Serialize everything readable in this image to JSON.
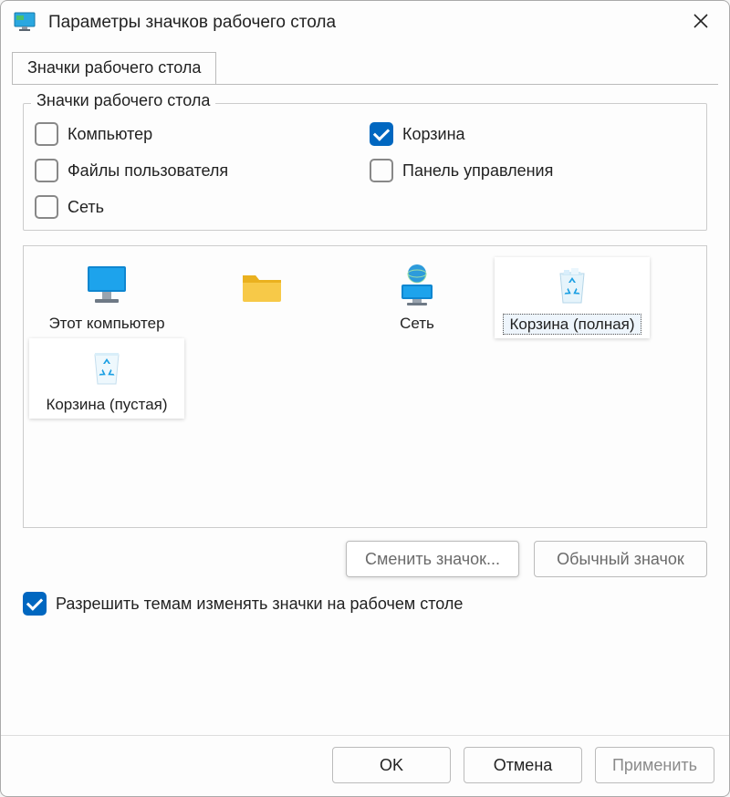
{
  "title": "Параметры значков рабочего стола",
  "tab": {
    "label": "Значки рабочего стола"
  },
  "group": {
    "label": "Значки рабочего стола",
    "checkboxes": [
      {
        "label": "Компьютер",
        "checked": false
      },
      {
        "label": "Корзина",
        "checked": true
      },
      {
        "label": "Файлы пользователя",
        "checked": false
      },
      {
        "label": "Панель управления",
        "checked": false
      },
      {
        "label": "Сеть",
        "checked": false
      }
    ]
  },
  "icons": [
    {
      "label": "Этот компьютер",
      "type": "monitor",
      "selected": false,
      "highlight": false
    },
    {
      "label": "",
      "type": "folder",
      "selected": false,
      "highlight": false
    },
    {
      "label": "Сеть",
      "type": "network",
      "selected": false,
      "highlight": false
    },
    {
      "label": "Корзина (полная)",
      "type": "bin-full",
      "selected": true,
      "highlight": true
    },
    {
      "label": "Корзина (пустая)",
      "type": "bin-empty",
      "selected": false,
      "highlight": true
    }
  ],
  "buttons": {
    "change_icon": "Сменить значок...",
    "default_icon": "Обычный значок"
  },
  "allow_themes": {
    "label": "Разрешить темам изменять значки на рабочем столе",
    "checked": true
  },
  "footer": {
    "ok": "OK",
    "cancel": "Отмена",
    "apply": "Применить"
  }
}
